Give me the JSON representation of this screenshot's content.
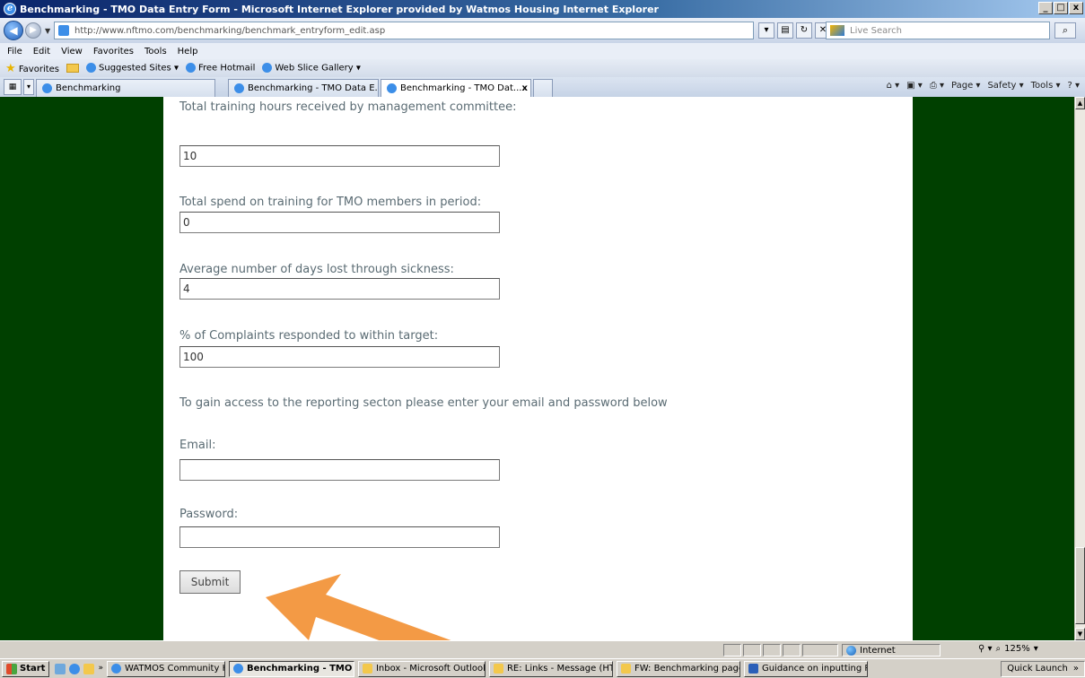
{
  "window": {
    "title": "Benchmarking - TMO Data Entry Form - Microsoft Internet Explorer provided by Watmos Housing Internet Explorer",
    "controls": [
      "_",
      "□",
      "x"
    ]
  },
  "address_bar": {
    "url": "http://www.nftmo.com/benchmarking/benchmark_entryform_edit.asp",
    "search_placeholder": "Live Search"
  },
  "menu": [
    "File",
    "Edit",
    "View",
    "Favorites",
    "Tools",
    "Help"
  ],
  "favorites_bar": {
    "label": "Favorites",
    "items": [
      "Suggested Sites ▾",
      "Free Hotmail",
      "Web Slice Gallery ▾"
    ]
  },
  "tabs": [
    {
      "label": "Benchmarking",
      "active": false
    },
    {
      "label": "Benchmarking - TMO Data E...",
      "active": false
    },
    {
      "label": "Benchmarking - TMO Dat...",
      "active": true,
      "close": "x"
    }
  ],
  "command_bar": [
    "Page ▾",
    "Safety ▾",
    "Tools ▾"
  ],
  "form": {
    "fields": [
      {
        "label": "Total training hours received by management committee:",
        "value": "10"
      },
      {
        "label": "Total spend on training for TMO members in period:",
        "value": "0"
      },
      {
        "label": "Average number of days lost through sickness:",
        "value": "4"
      },
      {
        "label": "% of Complaints responded to within target:",
        "value": "100"
      }
    ],
    "reporting_note": "To gain access to the reporting secton please enter your email and password below",
    "email_label": "Email:",
    "email_value": "",
    "password_label": "Password:",
    "password_value": "",
    "submit_label": "Submit"
  },
  "colors": {
    "sidebar_green": "#004000",
    "label_text": "#5a6b73",
    "annotation_arrow": "#f39a45"
  },
  "status_bar": {
    "zone": "Internet",
    "zoom": "125%"
  },
  "taskbar": {
    "start": "Start",
    "tasks": [
      {
        "label": "WATMOS Community Ho...",
        "active": false
      },
      {
        "label": "Benchmarking - TMO ...",
        "active": true
      },
      {
        "label": "Inbox - Microsoft Outlook",
        "active": false
      },
      {
        "label": "RE: Links - Message (HT...",
        "active": false
      },
      {
        "label": "FW: Benchmarking page...",
        "active": false
      },
      {
        "label": "Guidance on inputting P1...",
        "active": false
      }
    ],
    "quick_launch": "Quick Launch"
  }
}
